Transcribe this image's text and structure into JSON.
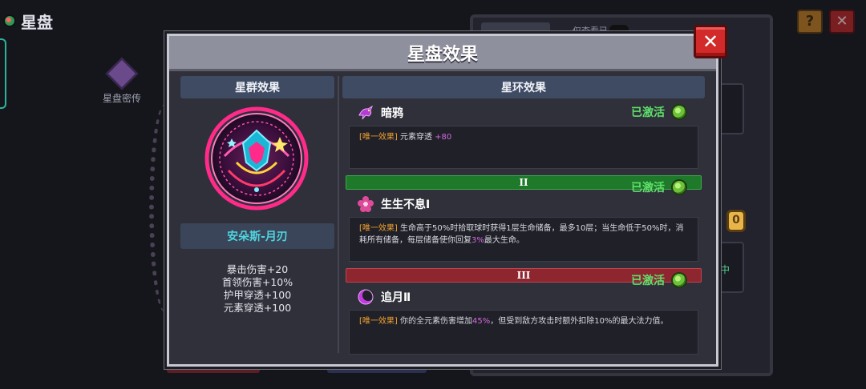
{
  "screen": {
    "title": "星盘",
    "secret_label": "星盘密传",
    "right_tab_label": "仅查看已",
    "coin_value": "0",
    "slot_text": "中",
    "help_label": "?",
    "close_label": "✕"
  },
  "modal": {
    "title": "星盘效果",
    "close_label": "✕"
  },
  "constellation": {
    "header": "星群效果",
    "hero_name": "安朵斯-月刃",
    "stats": [
      "暴击伤害+20",
      "首领伤害+10%",
      "护甲穿透+100",
      "元素穿透+100"
    ]
  },
  "rings": {
    "header": "星环效果",
    "items": [
      {
        "name": "暗鸦",
        "icon": "crow-icon",
        "status": "已激活",
        "tag": "[唯一效果]",
        "desc_before": " 元素穿透 ",
        "desc_highlight": "+80",
        "desc_after": ""
      },
      {
        "tier": "II",
        "name": "生生不息Ⅰ",
        "icon": "blossom-icon",
        "status": "已激活",
        "tag": "[唯一效果]",
        "desc_before": " 生命高于50%时拾取球时获得1层生命储备，最多10层；当生命低于50%时，消耗所有储备，每层储备使你回复",
        "desc_highlight": "3%",
        "desc_after": "最大生命。"
      },
      {
        "tier": "III",
        "name": "追月Ⅱ",
        "icon": "crescent-moon-icon",
        "status": "已激活",
        "tag": "[唯一效果]",
        "desc_before": " 你的全元素伤害增加",
        "desc_highlight": "45%",
        "desc_after": "，但受到敌方攻击时额外扣除10%的最大法力值。"
      }
    ]
  },
  "colors": {
    "active_green": "#5fe06a",
    "tag_orange": "#f0a030",
    "highlight_purple": "#d46ae0",
    "hero_cyan": "#4fd6e0",
    "close_red": "#d22a2a"
  }
}
